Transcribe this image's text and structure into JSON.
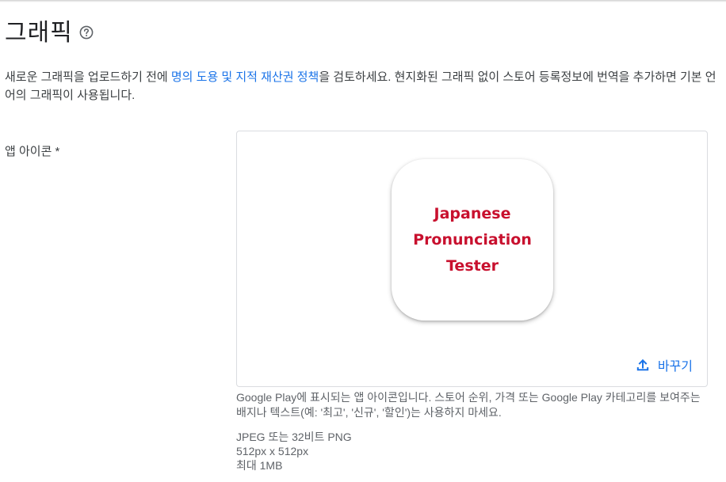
{
  "page": {
    "title": "그래픽",
    "intro_before": "새로운 그래픽을 업로드하기 전에 ",
    "intro_link": "명의 도용 및 지적 재산권 정책",
    "intro_after": "을 검토하세요. 현지화된 그래픽 없이 스토어 등록정보에 번역을 추가하면 기본 언어의 그래픽이 사용됩니다."
  },
  "app_icon_field": {
    "label": "앱 아이콘 *",
    "icon_text": [
      "Japanese",
      "Pronunciation",
      "Tester"
    ],
    "icon_text_color": "#c8102e",
    "replace_label": "바꾸기",
    "help_text": "Google Play에 표시되는 앱 아이콘입니다. 스토어 순위, 가격 또는 Google Play 카테고리를 보여주는 배지나 텍스트(예: '최고', '신규', '할인')는 사용하지 마세요.",
    "specs": [
      "JPEG 또는 32비트 PNG",
      "512px x 512px",
      "최대 1MB"
    ]
  },
  "icons": {
    "help": "help-circle-icon",
    "upload": "upload-icon"
  },
  "colors": {
    "link": "#1a73e8",
    "border": "#dadce0"
  }
}
